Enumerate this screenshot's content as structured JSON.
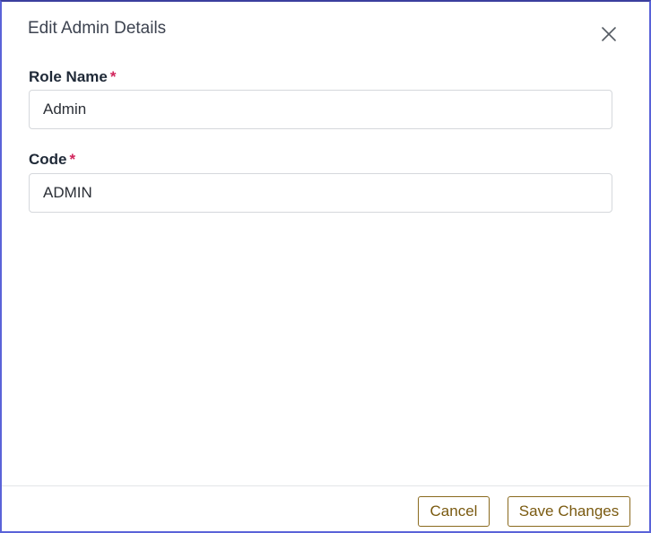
{
  "dialog": {
    "title": "Edit Admin Details"
  },
  "form": {
    "role_name": {
      "label": "Role Name",
      "required_mark": "*",
      "value": "Admin"
    },
    "code": {
      "label": "Code",
      "required_mark": "*",
      "value": "ADMIN"
    }
  },
  "footer": {
    "cancel_label": "Cancel",
    "save_label": "Save Changes"
  },
  "colors": {
    "dialog_border": "#5a63d8",
    "required_star": "#d1245b",
    "button_text": "#7a5a10",
    "button_border": "#8a6a1e"
  },
  "icons": {
    "close": "close-icon"
  }
}
